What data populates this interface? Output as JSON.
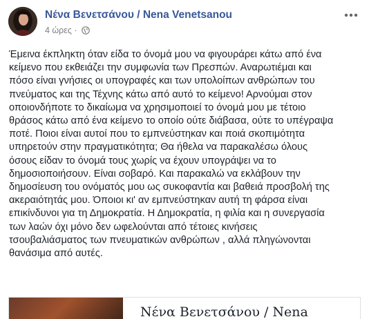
{
  "post": {
    "author": "Νένα Βενετσάνου / Nena Venetsanou",
    "time": "4 ώρες ·",
    "privacy_icon": "globe-icon",
    "more_icon": "more-dots-icon",
    "text": "Έμεινα έκπληκτη όταν είδα το όνομά μου να φιγουράρει κάτω από ένα\nκείμενο που εκθειάζει την συμφωνία των Πρεσπών. Αναρωτιέμαι και\nπόσο είναι γνήσιες οι υπογραφές και των υπολοίπων ανθρώπων του\nπνεύματος και της Τέχνης κάτω από αυτό το κείμενο! Αρνούμαι στον\nοποιονδήποτε το δικαίωμα να χρησιμοποιεί το όνομά μου με τέτοιο\nθράσος κάτω από ένα κείμενο το οποίο ούτε διάβασα, ούτε το υπέγραψα\nποτέ. Ποιοι είναι αυτοί που το εμπνεύστηκαν και ποιά σκοπιμότητα\nυπηρετούν στην πραγματικότητα; Θα ήθελα να παρακαλέσω όλους\nόσους είδαν το όνομά τους χωρίς να έχουν υπογράψει να το\nδημοσιοποιήσουν. Είναι σοβαρό. Και παρακαλώ να εκλάβουν την\nδημοσίευση του ονόματός μου ως συκοφαντία και βαθειά προσβολή της\nακεραιότητάς μου. Όποιοι κι' αν εμπνεύστηκαν αυτή τη φάρσα είναι\nεπικίνδυνοι για τη Δημοκρατία. Η Δημοκρατία, η φιλία και η συνεργασία\nτων λαών όχι μόνο δεν ωφελούνται από τέτοιες κινήσεις\nτσουβαλιάσματος των πνευματικών ανθρώπων , αλλά πληγώνονται\nθανάσιμα από αυτές."
  },
  "shared": {
    "name": "Νένα Βενετσάνου / Nena"
  },
  "colors": {
    "author_link": "#385898",
    "body_text": "#1d2129",
    "meta_text": "#7f7f7f"
  }
}
